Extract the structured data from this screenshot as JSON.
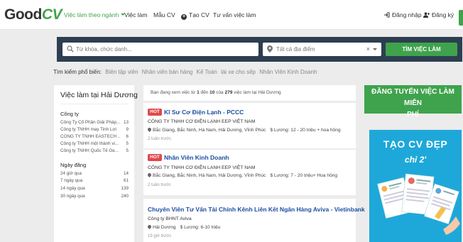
{
  "header": {
    "logo_good": "Good",
    "logo_cv": "CV",
    "nav": [
      "Việc làm theo ngành",
      "Việc làm",
      "Mẫu CV",
      "Tạo CV",
      "Tư vấn việc làm"
    ],
    "login": "Đăng nhập",
    "register": "Đăng ký"
  },
  "search": {
    "keyword_placeholder": "Từ khóa, chức danh...",
    "location_value": "Tất cả địa điểm",
    "clear": "×",
    "button": "TÌM VIỆC LÀM"
  },
  "popular": {
    "label": "Tìm kiếm phổ biến:",
    "tags": [
      "Biên tập viên",
      "Nhân viên bán hàng",
      "Kế Toán",
      "lái xe cho sếp",
      "Nhân Viên Kinh Doanh"
    ]
  },
  "sidebar": {
    "title": "Việc làm tại Hải Dương",
    "company_heading": "Công ty",
    "companies": [
      {
        "name": "Công Ty Cổ Phần Giải Pháp...",
        "count": "13"
      },
      {
        "name": "Công ty TNHH may Tinh Lợi",
        "count": "9"
      },
      {
        "name": "CÔNG TY TNHH EASTECH ...",
        "count": "6"
      },
      {
        "name": "Công ty TNHH một thành vi...",
        "count": "5"
      },
      {
        "name": "Công ty TNHH Quốc Tế Ge...",
        "count": "5"
      }
    ],
    "date_heading": "Ngày đăng",
    "dates": [
      {
        "name": "24 giờ qua",
        "count": "14"
      },
      {
        "name": "7 ngày qua",
        "count": "61"
      },
      {
        "name": "14 ngày qua",
        "count": "139"
      },
      {
        "name": "30 ngày qua",
        "count": "240"
      }
    ]
  },
  "summary": {
    "prefix": "Bạn đang xem việc từ ",
    "from": "1",
    "mid1": " đến ",
    "to": "10",
    "mid2": " của ",
    "total": "279",
    "suffix": " việc làm tại Hải Dương"
  },
  "jobs": [
    {
      "hot": "HOT",
      "title": "Kĩ Sư Cơ Điện Lạnh - PCCC",
      "company": "CÔNG TY TNHH CƠ ĐIỆN LẠNH EEP VIỆT NAM",
      "location": "Bắc Giang, Bắc Ninh, Hà Nam, Hải Dương, Vĩnh Phúc",
      "salary": "Lương: 12 - 20 triệu + hoa hồng",
      "ago": "2 tuần trước"
    },
    {
      "hot": "HOT",
      "title": "Nhân Viên Kinh Doanh",
      "company": "CÔNG TY TNHH CƠ ĐIỆN LẠNH EEP VIỆT NAM",
      "location": "Bắc Giang, Bắc Ninh, Hà Nam, Hải Dương, Vĩnh Phúc",
      "salary": "Lương: 7 - 20 triệu+ Hoa hồng",
      "ago": "2 tuần trước"
    },
    {
      "title": "Chuyên Viên Tư Vấn Tài Chính Kênh Liên Kết Ngân Hàng Aviva - Vietinbank",
      "company": "Công ty BHNT Aviva",
      "location": "Hải Dương",
      "salary": "Lương: 6-10 triệu",
      "ago": "19 giờ trước"
    }
  ],
  "promo": {
    "line1": "ĐĂNG TUYỂN VIỆC LÀM MIỄN",
    "line2": "PHÍ"
  },
  "banner": {
    "title": "TẠO CV ĐẸP",
    "subtitle": "chỉ 2'"
  },
  "colors": {
    "brand_green": "#3fa34d",
    "search_bg": "#2d3e50",
    "hot_red": "#e0494c",
    "job_title_blue": "#1b4fa0",
    "banner_blue": "#1ea8d9"
  }
}
